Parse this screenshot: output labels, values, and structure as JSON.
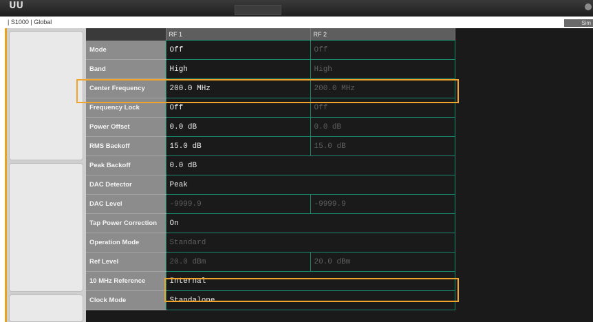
{
  "app": {
    "logo": "UU",
    "top_center_button": "",
    "breadcrumb": "| S1000 | Global",
    "sim_button": "Sim"
  },
  "table": {
    "columns": [
      "RF 1",
      "RF 2"
    ],
    "rows": [
      {
        "label": "Mode",
        "cells": [
          {
            "text": "Off",
            "dim": false,
            "span": 1
          },
          {
            "text": "Off",
            "dim": true,
            "span": 1
          }
        ]
      },
      {
        "label": "Band",
        "cells": [
          {
            "text": "High",
            "dim": false,
            "span": 1
          },
          {
            "text": "High",
            "dim": true,
            "span": 1
          }
        ]
      },
      {
        "label": "Center Frequency",
        "cells": [
          {
            "text": "200.0 MHz",
            "dim": false,
            "span": 1
          },
          {
            "text": "200.0 MHz",
            "dim": true,
            "span": 1
          }
        ]
      },
      {
        "label": "Frequency Lock",
        "cells": [
          {
            "text": "Off",
            "dim": false,
            "span": 1
          },
          {
            "text": "Off",
            "dim": true,
            "span": 1
          }
        ]
      },
      {
        "label": "Power Offset",
        "cells": [
          {
            "text": "0.0 dB",
            "dim": false,
            "span": 1
          },
          {
            "text": "0.0 dB",
            "dim": true,
            "span": 1
          }
        ]
      },
      {
        "label": "RMS Backoff",
        "cells": [
          {
            "text": "15.0 dB",
            "dim": false,
            "span": 1
          },
          {
            "text": "15.0 dB",
            "dim": true,
            "span": 1
          }
        ]
      },
      {
        "label": "Peak Backoff",
        "cells": [
          {
            "text": "0.0 dB",
            "dim": false,
            "span": 2
          }
        ]
      },
      {
        "label": "DAC Detector",
        "cells": [
          {
            "text": "Peak",
            "dim": false,
            "span": 2
          }
        ]
      },
      {
        "label": "DAC Level",
        "cells": [
          {
            "text": "-9999.9",
            "dim": true,
            "span": 1
          },
          {
            "text": "-9999.9",
            "dim": true,
            "span": 1
          }
        ]
      },
      {
        "label": "Tap Power Correction",
        "cells": [
          {
            "text": "On",
            "dim": false,
            "span": 2
          }
        ]
      },
      {
        "label": "Operation Mode",
        "cells": [
          {
            "text": "Standard",
            "dim": true,
            "span": 2
          }
        ]
      },
      {
        "label": "Ref Level",
        "cells": [
          {
            "text": "20.0 dBm",
            "dim": true,
            "span": 1
          },
          {
            "text": "20.0 dBm",
            "dim": true,
            "span": 1
          }
        ]
      },
      {
        "label": "10 MHz Reference",
        "cells": [
          {
            "text": "Internal",
            "dim": false,
            "span": 2
          }
        ]
      },
      {
        "label": "Clock Mode",
        "cells": [
          {
            "text": "Standalone",
            "dim": false,
            "span": 2
          }
        ]
      }
    ]
  },
  "colors": {
    "accent": "#f0a52a",
    "grid_line": "#1a8a6d",
    "label_bg": "#8c8c8c",
    "cell_bg": "#1a1a1a"
  }
}
